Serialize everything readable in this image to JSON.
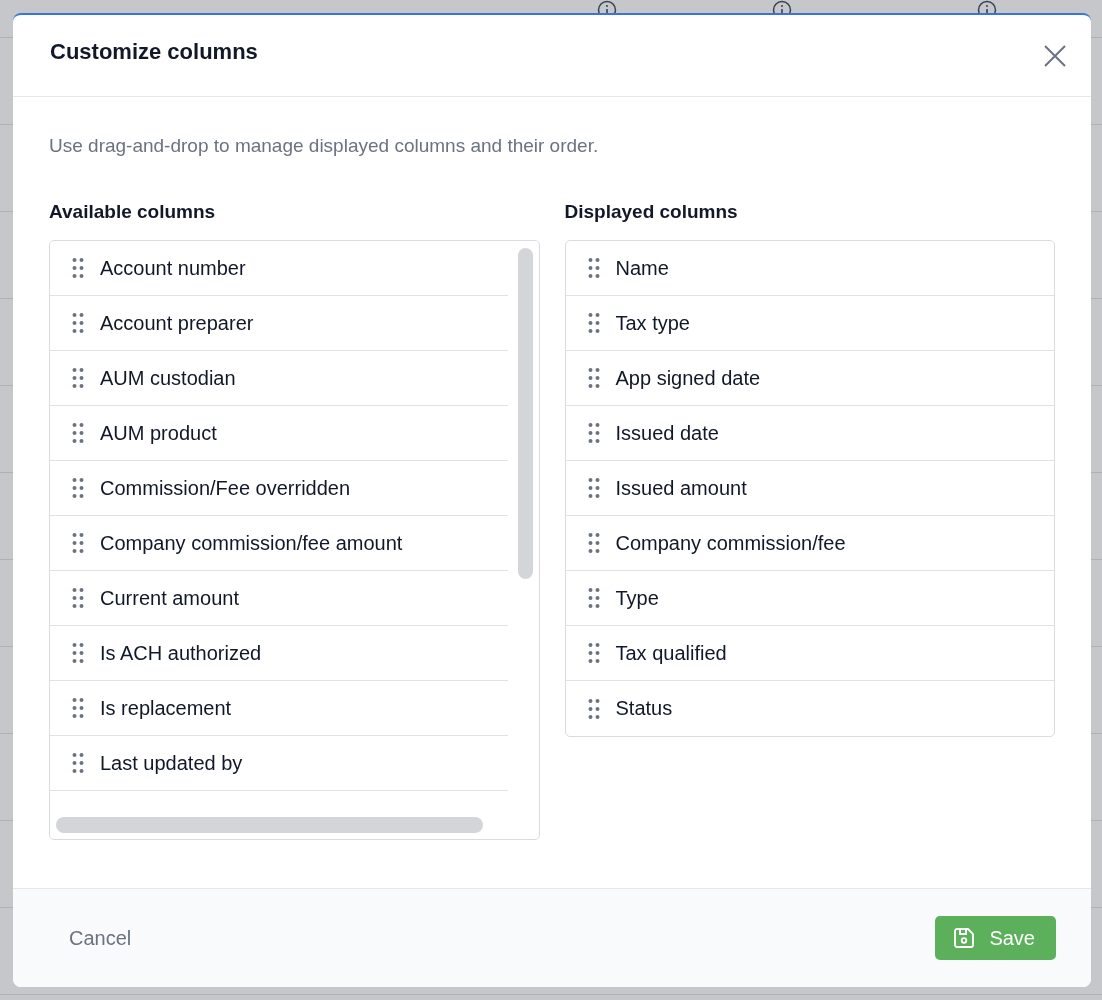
{
  "dialog": {
    "title": "Customize columns",
    "description": "Use drag-and-drop to manage displayed columns and their order.",
    "available": {
      "heading": "Available columns",
      "items": [
        "Account number",
        "Account preparer",
        "AUM custodian",
        "AUM product",
        "Commission/Fee overridden",
        "Company commission/fee amount",
        "Current amount",
        "Is ACH authorized",
        "Is replacement",
        "Last updated by"
      ]
    },
    "displayed": {
      "heading": "Displayed columns",
      "items": [
        "Name",
        "Tax type",
        "App signed date",
        "Issued date",
        "Issued amount",
        "Company commission/fee",
        "Type",
        "Tax qualified",
        "Status"
      ]
    },
    "buttons": [
      {
        "kind": "cancel",
        "label": "Cancel"
      },
      {
        "kind": "save",
        "label": "Save"
      }
    ]
  }
}
